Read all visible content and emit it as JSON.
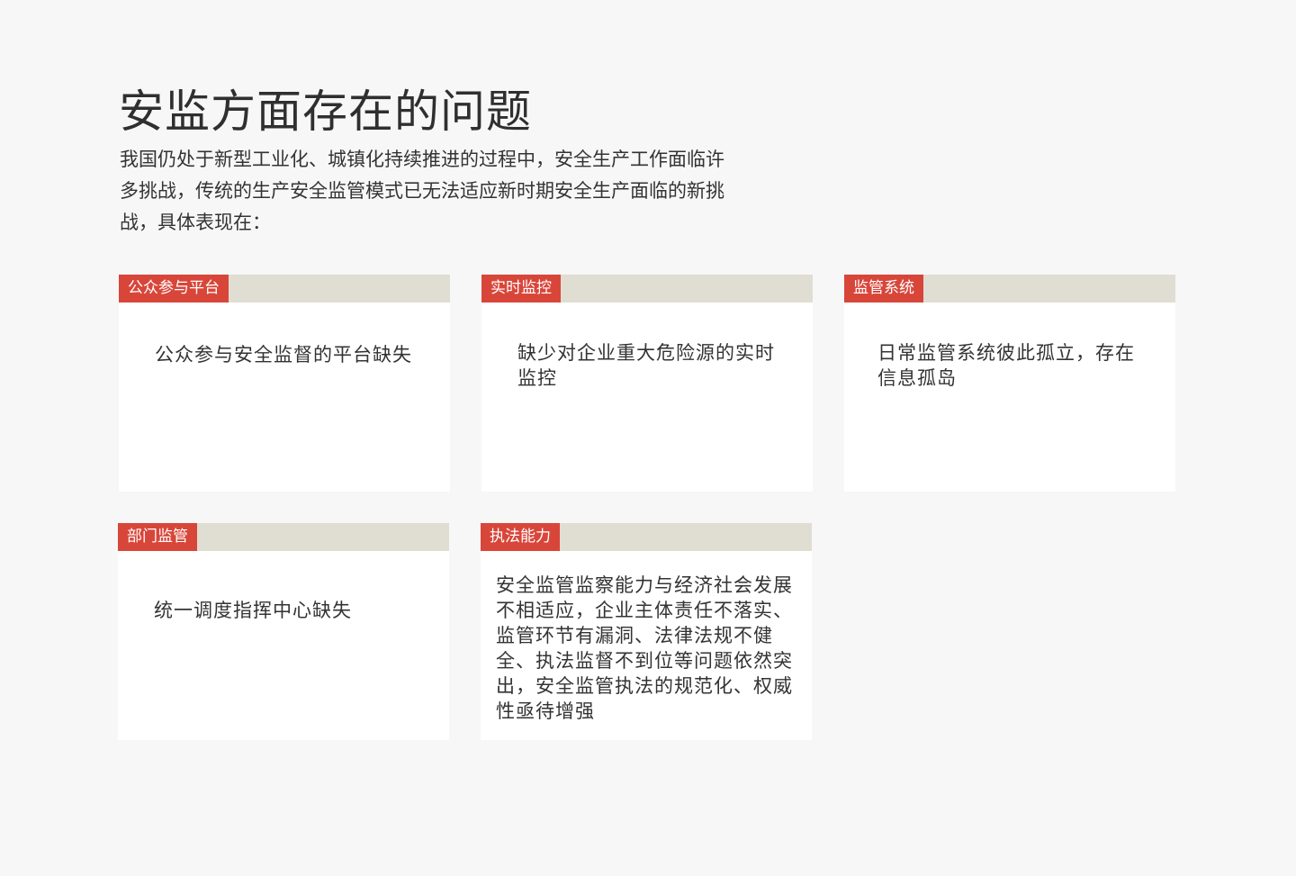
{
  "header": {
    "title": "安监方面存在的问题",
    "intro": "我国仍处于新型工业化、城镇化持续推进的过程中，安全生产工作面临许多挑战，传统的生产安全监管模式已无法适应新时期安全生产面临的新挑战，具体表现在："
  },
  "cards": [
    {
      "tag": "公众参与平台",
      "text": "公众参与安全监督的平台缺失"
    },
    {
      "tag": "实时监控",
      "text": "缺少对企业重大危险源的实时监控"
    },
    {
      "tag": "监管系统",
      "text": "日常监管系统彼此孤立，存在信息孤岛"
    },
    {
      "tag": "部门监管",
      "text": "统一调度指挥中心缺失"
    },
    {
      "tag": "执法能力",
      "text": "安全监管监察能力与经济社会发展不相适应，企业主体责任不落实、监管环节有漏洞、法律法规不健全、执法监督不到位等问题依然突出，安全监管执法的规范化、权威性亟待增强"
    }
  ],
  "colors": {
    "background": "#f7f7f7",
    "tag": "#d8463a",
    "header_bar": "#e0ddd2",
    "card": "#ffffff"
  }
}
